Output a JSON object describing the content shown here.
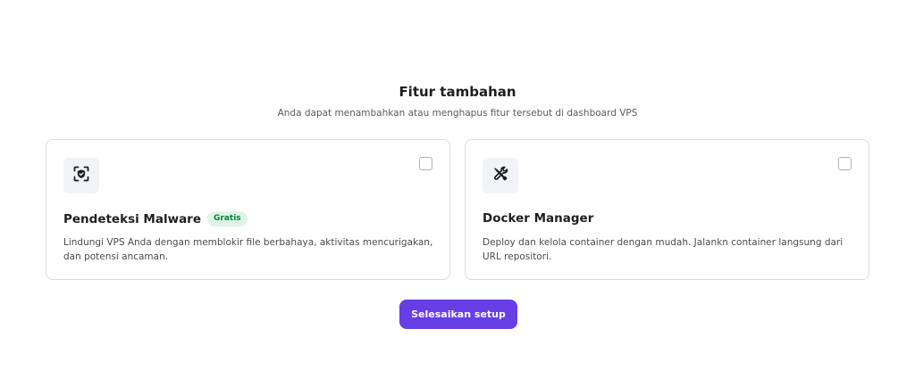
{
  "header": {
    "title": "Fitur tambahan",
    "subtitle": "Anda dapat menambahkan atau menghapus fitur tersebut di dashboard VPS"
  },
  "features": [
    {
      "icon": "shield-scan-icon",
      "title": "Pendeteksi Malware",
      "badge": "Gratis",
      "description": "Lindungi VPS Anda dengan memblokir file berbahaya, aktivitas mencurigakan, dan potensi ancaman.",
      "checked": false
    },
    {
      "icon": "tools-icon",
      "title": "Docker Manager",
      "description": "Deploy dan kelola container dengan mudah. Jalankn container langsung dari URL repositori.",
      "checked": false
    }
  ],
  "actions": {
    "finish_label": "Selesaikan setup"
  },
  "colors": {
    "accent": "#673de6",
    "badge_text": "#00833d",
    "badge_bg": "#def4e6"
  }
}
